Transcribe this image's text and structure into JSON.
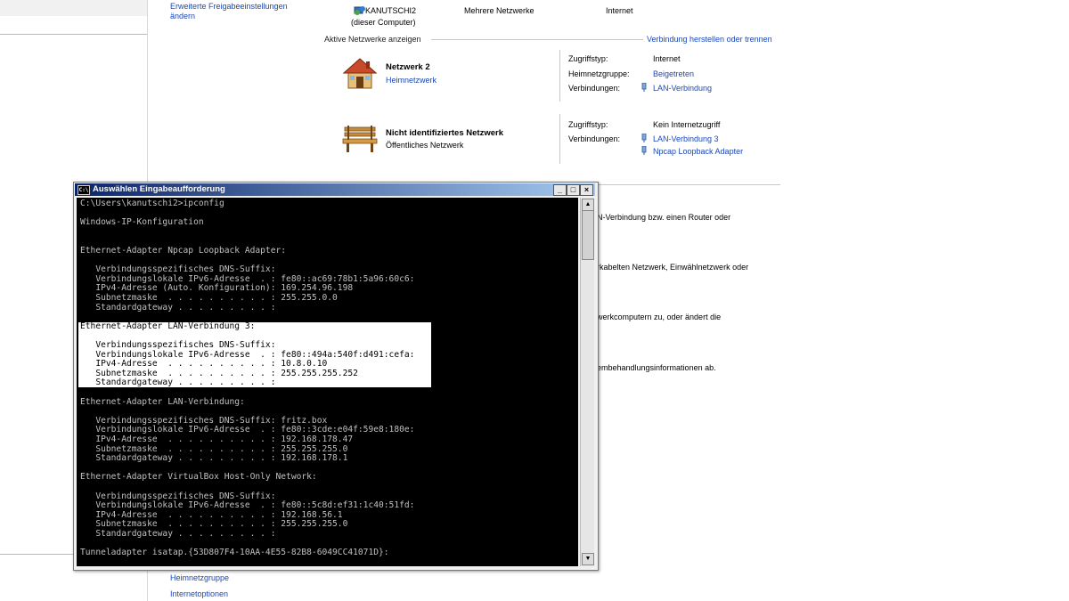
{
  "left": {
    "links_top": "",
    "bottom_links": [
      "Heimnetzgruppe",
      "Internetoptionen"
    ]
  },
  "top": {
    "adv_sharing_link": "Erweiterte Freigabeeinstellungen\nändern",
    "computer_name": "KANUTSCHI2",
    "computer_sub": "(dieser Computer)",
    "networks": "Mehrere Netzwerke",
    "internet": "Internet"
  },
  "active": {
    "heading": "Aktive Netzwerke anzeigen",
    "connect_link": "Verbindung herstellen oder trennen"
  },
  "net1": {
    "name": "Netzwerk  2",
    "type": "Heimnetzwerk",
    "access_label": "Zugriffstyp:",
    "access_value": "Internet",
    "homegroup_label": "Heimnetzgruppe:",
    "homegroup_value": "Beigetreten",
    "conn_label": "Verbindungen:",
    "conn_value": "LAN-Verbindung"
  },
  "net2": {
    "name": "Nicht identifiziertes Netzwerk",
    "type": "Öffentliches Netzwerk",
    "access_label": "Zugriffstyp:",
    "access_value": "Kein Internetzugriff",
    "conn_label": "Verbindungen:",
    "conn_value1": "LAN-Verbindung 3",
    "conn_value2": "Npcap Loopback Adapter"
  },
  "tasks": [
    "N-Verbindung bzw. einen Router oder",
    "rkabelten Netzwerk, Einwählnetzwerk oder",
    "werkcomputern zu, oder ändert die",
    "embehandlungsinformationen ab."
  ],
  "cmd": {
    "title": "Auswählen Eingabeaufforderung",
    "icon_text": "C:\\",
    "lines": [
      "C:\\Users\\kanutschi2>ipconfig",
      "",
      "Windows-IP-Konfiguration",
      "",
      "",
      "Ethernet-Adapter Npcap Loopback Adapter:",
      "",
      "   Verbindungsspezifisches DNS-Suffix:",
      "   Verbindungslokale IPv6-Adresse  . : fe80::ac69:78b1:5a96:60c6:",
      "   IPv4-Adresse (Auto. Konfiguration): 169.254.96.198",
      "   Subnetzmaske  . . . . . . . . . . : 255.255.0.0",
      "   Standardgateway . . . . . . . . . :",
      "",
      "Ethernet-Adapter LAN-Verbindung 3:",
      "",
      "   Verbindungsspezifisches DNS-Suffix:",
      "   Verbindungslokale IPv6-Adresse  . : fe80::494a:540f:d491:cefa:",
      "   IPv4-Adresse  . . . . . . . . . . : 10.8.0.10",
      "   Subnetzmaske  . . . . . . . . . . : 255.255.255.252",
      "   Standardgateway . . . . . . . . . :",
      "",
      "Ethernet-Adapter LAN-Verbindung:",
      "",
      "   Verbindungsspezifisches DNS-Suffix: fritz.box",
      "   Verbindungslokale IPv6-Adresse  . : fe80::3cde:e04f:59e8:180e:",
      "   IPv4-Adresse  . . . . . . . . . . : 192.168.178.47",
      "   Subnetzmaske  . . . . . . . . . . : 255.255.255.0",
      "   Standardgateway . . . . . . . . . : 192.168.178.1",
      "",
      "Ethernet-Adapter VirtualBox Host-Only Network:",
      "",
      "   Verbindungsspezifisches DNS-Suffix:",
      "   Verbindungslokale IPv6-Adresse  . : fe80::5c8d:ef31:1c40:51fd:",
      "   IPv4-Adresse  . . . . . . . . . . : 192.168.56.1",
      "   Subnetzmaske  . . . . . . . . . . : 255.255.255.0",
      "   Standardgateway . . . . . . . . . :",
      "",
      "Tunneladapter isatap.{53D807F4-10AA-4E55-82B8-6049CC41071D}:"
    ]
  }
}
